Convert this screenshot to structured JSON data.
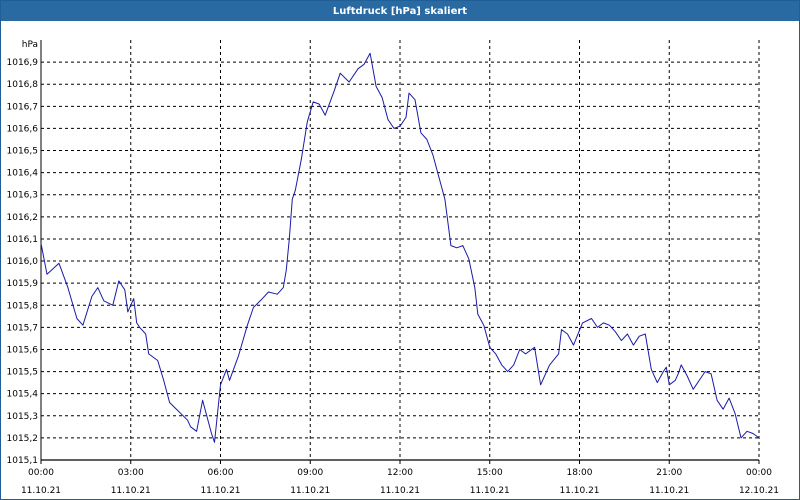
{
  "window": {
    "title": "Luftdruck [hPa] skaliert"
  },
  "colors": {
    "titlebar": "#2a6aa3",
    "line": "#1a1aa6",
    "grid": "#000000"
  },
  "chart_data": {
    "type": "line",
    "title": "Luftdruck [hPa] skaliert",
    "ylabel": "hPa",
    "xlabel": "",
    "ylim": [
      1015.1,
      1017.0
    ],
    "y_ticks": [
      "1015,1",
      "1015,2",
      "1015,3",
      "1015,4",
      "1015,5",
      "1015,6",
      "1015,7",
      "1015,8",
      "1015,9",
      "1016,0",
      "1016,1",
      "1016,2",
      "1016,3",
      "1016,4",
      "1016,5",
      "1016,6",
      "1016,7",
      "1016,8",
      "1016,9"
    ],
    "y_tick_values": [
      1015.1,
      1015.2,
      1015.3,
      1015.4,
      1015.5,
      1015.6,
      1015.7,
      1015.8,
      1015.9,
      1016.0,
      1016.1,
      1016.2,
      1016.3,
      1016.4,
      1016.5,
      1016.6,
      1016.7,
      1016.8,
      1016.9
    ],
    "x_ticks": [
      {
        "time": "00:00",
        "date": "11.10.21"
      },
      {
        "time": "03:00",
        "date": "11.10.21"
      },
      {
        "time": "06:00",
        "date": "11.10.21"
      },
      {
        "time": "09:00",
        "date": "11.10.21"
      },
      {
        "time": "12:00",
        "date": "11.10.21"
      },
      {
        "time": "15:00",
        "date": "11.10.21"
      },
      {
        "time": "18:00",
        "date": "11.10.21"
      },
      {
        "time": "21:00",
        "date": "11.10.21"
      },
      {
        "time": "00:00",
        "date": "12.10.21"
      }
    ],
    "grid": true,
    "series": [
      {
        "x_hours": [
          0,
          0.2,
          0.6,
          0.9,
          1.2,
          1.4,
          1.7,
          1.9,
          2.1,
          2.4,
          2.6,
          2.8,
          2.9,
          3.1,
          3.2,
          3.3,
          3.5,
          3.6,
          3.9,
          4.1,
          4.3,
          4.6,
          4.9,
          5.0,
          5.2,
          5.4,
          5.7,
          5.8,
          6.0,
          6.2,
          6.3,
          6.6,
          6.9,
          7.1,
          7.4,
          7.6,
          7.9,
          8.1,
          8.2,
          8.3,
          8.4,
          8.5,
          8.7,
          8.9,
          9.1,
          9.3,
          9.5,
          9.8,
          10.0,
          10.3,
          10.6,
          10.8,
          11.0,
          11.2,
          11.4,
          11.6,
          11.8,
          12.0,
          12.2,
          12.3,
          12.5,
          12.7,
          12.9,
          13.1,
          13.3,
          13.5,
          13.7,
          13.9,
          14.1,
          14.3,
          14.5,
          14.6,
          14.8,
          15.0,
          15.2,
          15.4,
          15.6,
          15.8,
          16.0,
          16.2,
          16.5,
          16.7,
          16.9,
          17.0,
          17.3,
          17.4,
          17.6,
          17.8,
          18.1,
          18.4,
          18.6,
          18.8,
          19.0,
          19.2,
          19.4,
          19.6,
          19.8,
          20.0,
          20.2,
          20.4,
          20.6,
          20.8,
          20.9,
          21.0,
          21.2,
          21.3,
          21.4,
          21.6,
          21.8,
          22.0,
          22.2,
          22.4,
          22.6,
          22.8,
          23.0,
          23.2,
          23.4,
          23.6,
          23.8,
          24.0
        ],
        "y": [
          1016.08,
          1015.94,
          1015.99,
          1015.88,
          1015.74,
          1015.71,
          1015.84,
          1015.88,
          1015.82,
          1015.8,
          1015.91,
          1015.87,
          1015.77,
          1015.83,
          1015.72,
          1015.7,
          1015.67,
          1015.58,
          1015.55,
          1015.46,
          1015.36,
          1015.32,
          1015.28,
          1015.25,
          1015.23,
          1015.37,
          1015.22,
          1015.18,
          1015.44,
          1015.51,
          1015.46,
          1015.57,
          1015.71,
          1015.79,
          1015.83,
          1015.86,
          1015.85,
          1015.88,
          1015.96,
          1016.1,
          1016.28,
          1016.32,
          1016.46,
          1016.63,
          1016.72,
          1016.71,
          1016.66,
          1016.77,
          1016.85,
          1016.81,
          1016.87,
          1016.89,
          1016.94,
          1016.79,
          1016.74,
          1016.64,
          1016.6,
          1016.61,
          1016.65,
          1016.76,
          1016.73,
          1016.58,
          1016.55,
          1016.48,
          1016.38,
          1016.28,
          1016.07,
          1016.06,
          1016.07,
          1016.01,
          1015.88,
          1015.76,
          1015.71,
          1015.61,
          1015.58,
          1015.53,
          1015.5,
          1015.53,
          1015.6,
          1015.58,
          1015.61,
          1015.44,
          1015.5,
          1015.53,
          1015.58,
          1015.69,
          1015.67,
          1015.62,
          1015.72,
          1015.74,
          1015.7,
          1015.72,
          1015.71,
          1015.68,
          1015.64,
          1015.67,
          1015.62,
          1015.66,
          1015.67,
          1015.51,
          1015.45,
          1015.5,
          1015.52,
          1015.44,
          1015.46,
          1015.49,
          1015.53,
          1015.48,
          1015.42,
          1015.46,
          1015.5,
          1015.49,
          1015.37,
          1015.33,
          1015.38,
          1015.31,
          1015.2,
          1015.23,
          1015.22,
          1015.2
        ]
      }
    ]
  }
}
